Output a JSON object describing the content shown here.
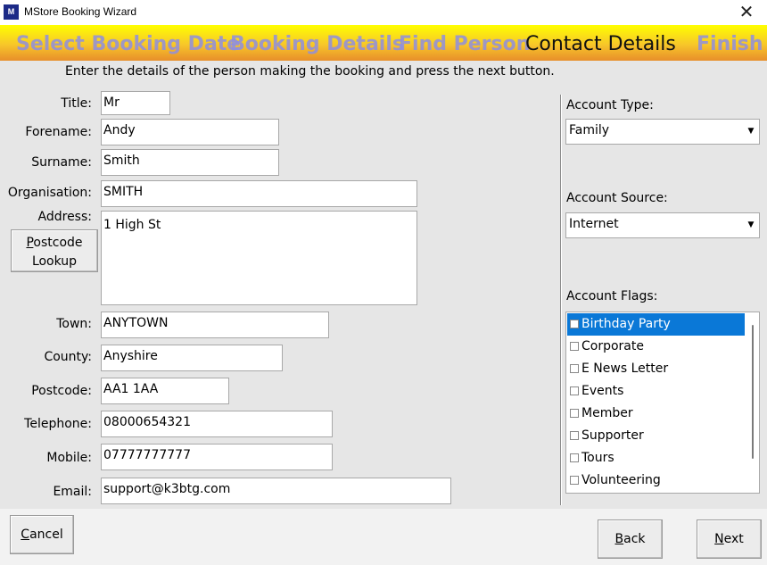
{
  "window": {
    "title": "MStore Booking Wizard",
    "icon_text": "M",
    "close_glyph": "✕"
  },
  "steps": [
    {
      "label": "Select Booking Date"
    },
    {
      "label": "Booking Details"
    },
    {
      "label": "Find Person"
    },
    {
      "label": "Contact Details"
    },
    {
      "label": "Finish"
    }
  ],
  "instruction": "Enter the details of the person making the booking and press the next button.",
  "form": {
    "title": {
      "label": "Title:",
      "value": "Mr"
    },
    "forename": {
      "label": "Forename:",
      "value": "Andy"
    },
    "surname": {
      "label": "Surname:",
      "value": "Smith"
    },
    "organisation": {
      "label": "Organisation:",
      "value": "SMITH"
    },
    "address": {
      "label": "Address:",
      "value": "1 High St"
    },
    "postcode_lookup": {
      "line1": "Postcode",
      "line2": "Lookup"
    },
    "town": {
      "label": "Town:",
      "value": "ANYTOWN"
    },
    "county": {
      "label": "County:",
      "value": "Anyshire"
    },
    "postcode": {
      "label": "Postcode:",
      "value": "AA1 1AA"
    },
    "telephone": {
      "label": "Telephone:",
      "value": "08000654321"
    },
    "mobile": {
      "label": "Mobile:",
      "value": "07777777777"
    },
    "email": {
      "label": "Email:",
      "value": "support@k3btg.com"
    }
  },
  "account": {
    "type": {
      "label": "Account Type:",
      "value": "Family"
    },
    "source": {
      "label": "Account Source:",
      "value": "Internet"
    },
    "flags": {
      "label": "Account Flags:",
      "items": [
        {
          "label": "Birthday Party",
          "checked": false,
          "selected": true
        },
        {
          "label": "Corporate",
          "checked": false,
          "selected": false
        },
        {
          "label": "E News Letter",
          "checked": false,
          "selected": false
        },
        {
          "label": "Events",
          "checked": false,
          "selected": false
        },
        {
          "label": "Member",
          "checked": false,
          "selected": false
        },
        {
          "label": "Supporter",
          "checked": false,
          "selected": false
        },
        {
          "label": "Tours",
          "checked": false,
          "selected": false
        },
        {
          "label": "Volunteering",
          "checked": false,
          "selected": false
        }
      ]
    }
  },
  "buttons": {
    "cancel": {
      "mnemonic": "C",
      "rest": "ancel"
    },
    "back": {
      "mnemonic": "B",
      "rest": "ack"
    },
    "next": {
      "mnemonic": "N",
      "rest": "ext"
    }
  },
  "colors": {
    "selection": "#0a78d7",
    "step_inactive": "#8f8fe0",
    "banner_top": "#ffff00",
    "banner_bottom": "#e88e2a"
  }
}
